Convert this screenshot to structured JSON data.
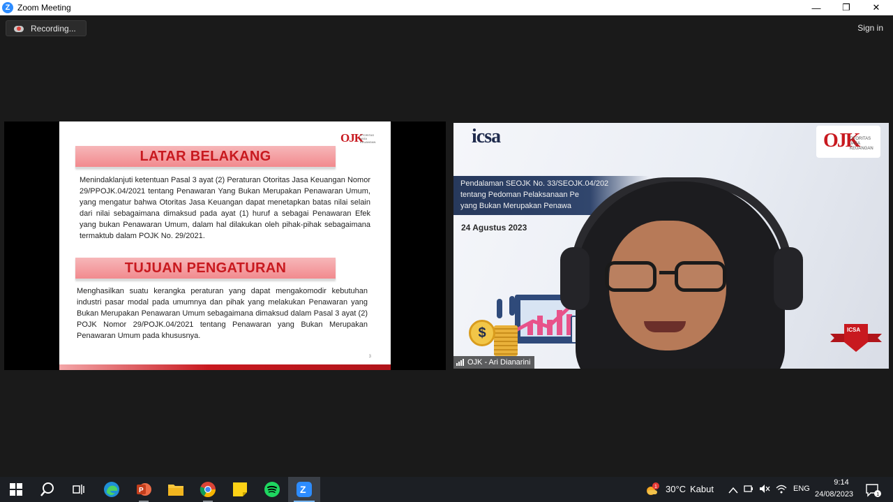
{
  "window": {
    "app_icon_letter": "Z",
    "title": "Zoom Meeting",
    "minimize_glyph": "—",
    "restore_glyph": "❐",
    "close_glyph": "✕"
  },
  "toolbar": {
    "recording_label": "Recording...",
    "signin_label": "Sign in"
  },
  "slide": {
    "logo_mark": "OJK",
    "logo_text_lines": [
      "OTORITAS",
      "JASA",
      "KEUANGAN"
    ],
    "heading1": "LATAR BELAKANG",
    "para1": "Menindaklanjuti ketentuan Pasal 3 ayat (2) Peraturan Otoritas Jasa Keuangan Nomor 29/PPOJK.04/2021 tentang Penawaran Yang Bukan Merupakan Penawaran Umum, yang mengatur bahwa Otoritas Jasa Keuangan dapat menetapkan batas nilai selain dari nilai sebagaimana dimaksud pada ayat (1) huruf a sebagai Penawaran Efek yang bukan Penawaran Umum, dalam hal dilakukan oleh pihak-pihak sebagaimana termaktub dalam POJK No. 29/2021.",
    "heading2": "TUJUAN PENGATURAN",
    "para2": "Menghasilkan suatu kerangka peraturan yang dapat mengakomodir kebutuhan industri pasar modal pada umumnya dan pihak yang melakukan Penawaran yang Bukan Merupakan Penawaran Umum sebagaimana dimaksud dalam Pasal 3 ayat (2) POJK Nomor 29/POJK.04/2021 tentang Penawaran yang Bukan Merupakan Penawaran Umum pada khususnya.",
    "page_number": "3"
  },
  "video": {
    "icsa_logo_text": "icsa",
    "ojk_logo_mark": "OJK",
    "ojk_logo_lines": [
      "OTORITAS",
      "JASA",
      "KEUANGAN"
    ],
    "banner_lines": [
      "Pendalaman SEOJK No. 33/SEOJK.04/202",
      "tentang Pedoman Pelaksanaan Pe",
      "yang Bukan Merupakan Penawa"
    ],
    "date_text": "24 Agustus 2023",
    "coin_symbol": "$",
    "badge_text": "ICSA",
    "participant_name": "OJK - Ari Dianarini"
  },
  "taskbar": {
    "apps": [
      {
        "name": "start",
        "icon": "windows-icon"
      },
      {
        "name": "search",
        "icon": "search-icon"
      },
      {
        "name": "task-view",
        "icon": "task-view-icon"
      },
      {
        "name": "edge",
        "icon": "edge-icon"
      },
      {
        "name": "powerpoint",
        "icon": "powerpoint-icon"
      },
      {
        "name": "file-explorer",
        "icon": "folder-icon"
      },
      {
        "name": "chrome",
        "icon": "chrome-icon"
      },
      {
        "name": "sticky-notes",
        "icon": "sticky-notes-icon"
      },
      {
        "name": "spotify",
        "icon": "spotify-icon"
      },
      {
        "name": "zoom",
        "icon": "zoom-icon"
      }
    ],
    "weather_temp": "30°C",
    "weather_desc": "Kabut",
    "weather_badge": "1",
    "language": "ENG",
    "time": "9:14",
    "date": "24/08/2023",
    "notification_count": "1"
  },
  "colors": {
    "ojk_red": "#c8191f",
    "zoom_blue": "#2d8cff",
    "background": "#1a1a1a"
  }
}
